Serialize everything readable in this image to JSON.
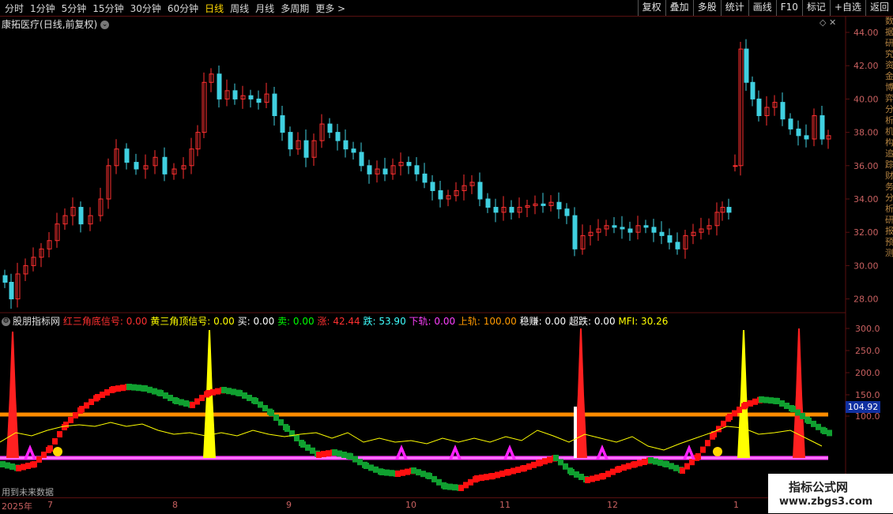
{
  "toolbar": {
    "periods": [
      "分时",
      "1分钟",
      "5分钟",
      "15分钟",
      "30分钟",
      "60分钟",
      "日线",
      "周线",
      "月线",
      "多周期",
      "更多 >"
    ],
    "active_period": "日线",
    "actions": [
      "复权",
      "叠加",
      "多股",
      "统计",
      "画线",
      "F10",
      "标记",
      "+自选",
      "返回"
    ]
  },
  "stock": {
    "name": "康拓医疗",
    "mode": "(日线,前复权)"
  },
  "price_axis": {
    "ticks": [
      "44.00",
      "42.00",
      "40.00",
      "38.00",
      "36.00",
      "34.00",
      "32.00",
      "30.00",
      "28.00"
    ]
  },
  "indicator": {
    "name": "股朋指标网",
    "fields": [
      {
        "label": "红三角底信号: 0.00",
        "color": "#ff3030"
      },
      {
        "label": "黄三角顶信号: 0.00",
        "color": "#ffff00"
      },
      {
        "label": "买: 0.00",
        "color": "#ffffff"
      },
      {
        "label": "卖: 0.00",
        "color": "#00ff00"
      },
      {
        "label": "涨: 42.44",
        "color": "#ff3030"
      },
      {
        "label": "跌: 53.90",
        "color": "#40ffff"
      },
      {
        "label": "下轨: 0.00",
        "color": "#ff40ff"
      },
      {
        "label": "上轨: 100.00",
        "color": "#ff9900"
      },
      {
        "label": "稳赚: 0.00",
        "color": "#ffffff"
      },
      {
        "label": "超跌: 0.00",
        "color": "#ffffff"
      },
      {
        "label": "MFI: 30.26",
        "color": "#ffff00"
      }
    ],
    "axis_ticks": [
      "300.0",
      "250.0",
      "200.0",
      "150.0",
      "100.0"
    ],
    "current_value": "104.92"
  },
  "dates": {
    "year": "2025年",
    "months": [
      "7",
      "8",
      "9",
      "10",
      "11",
      "12",
      "1"
    ]
  },
  "footer_note": "用到未来数据",
  "watermark": {
    "title": "指标公式网",
    "url": "www.zbgs3.com"
  },
  "sidebar_text": [
    "数",
    "据",
    "研",
    "究",
    "资",
    "金",
    "博",
    "弈",
    "分",
    "析",
    "机",
    "构",
    "追",
    "踪",
    "财",
    "务",
    "分",
    "析",
    "研",
    "报",
    "预",
    "测"
  ],
  "colors": {
    "up": "#ff3030",
    "down": "#40d0e0",
    "grid": "#5a1010",
    "upper_band": "#ff8c00",
    "lower_band": "#ff40ff",
    "mfi": "#ffff00"
  }
}
